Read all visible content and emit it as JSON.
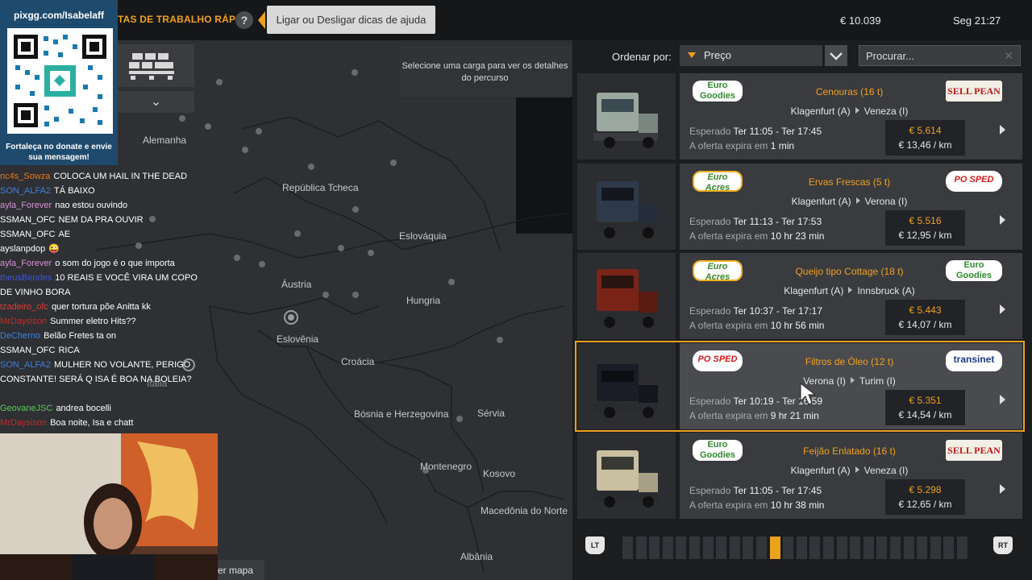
{
  "top_bar": {
    "quick_jobs_title": "TAS DE TRABALHO RÁPIDO",
    "help_icon_glyph": "?",
    "tip_toggle_label": "Ligar ou Desligar dicas de ajuda",
    "money": "€ 10.039",
    "clock": "Seg 21:27"
  },
  "map": {
    "route_hint": "Selecione uma carga para ver os detalhes do percurso",
    "view_map_label": "er mapa",
    "expand_glyph": "⌄",
    "countries": [
      {
        "name": "Alemanha"
      },
      {
        "name": "República Tcheca"
      },
      {
        "name": "Eslováquia"
      },
      {
        "name": "Áustria"
      },
      {
        "name": "Hungria"
      },
      {
        "name": "Eslovênia"
      },
      {
        "name": "Croácia"
      },
      {
        "name": "Bósnia e Herzegovina"
      },
      {
        "name": "Sérvia"
      },
      {
        "name": "Montenegro"
      },
      {
        "name": "Kosovo"
      },
      {
        "name": "Macedônia do Norte"
      },
      {
        "name": "Albânia"
      },
      {
        "name": "Itália"
      }
    ]
  },
  "stream_overlay": {
    "donate_title": "pixgg.com/Isabelaff",
    "donate_message": "Fortaleça no donate e envie sua mensagem!",
    "chat": [
      {
        "user": "nc4s_Sowza",
        "user_color": "#e07a1f",
        "message": "COLOCA UM HAIL IN THE DEAD"
      },
      {
        "user": "SON_ALFA2",
        "user_color": "#3d7fe0",
        "message": "TÁ BAIXO"
      },
      {
        "user": "ayla_Forever",
        "user_color": "#d68fd6",
        "message": "nao estou ouvindo"
      },
      {
        "user": "SSMAN_OFC",
        "user_color": "#ffffff",
        "message": "NEM DA PRA OUVIR"
      },
      {
        "user": "SSMAN_OFC",
        "user_color": "#ffffff",
        "message": "AE"
      },
      {
        "user": "ayslanpdop",
        "user_color": "#ffffff",
        "message": "😜"
      },
      {
        "user": "ayla_Forever",
        "user_color": "#d68fd6",
        "message": "o som do jogo é o que importa"
      },
      {
        "user": "theusBendes",
        "user_color": "#3a55d6",
        "message": "10 REAIS E VOCÊ VIRA UM COPO DE VINHO BORA"
      },
      {
        "user": "tzadeiro_ofc",
        "user_color": "#e03a3a",
        "message": "quer tortura põe Anitta kk"
      },
      {
        "user": "MrDaysison",
        "user_color": "#c02a2a",
        "message": "Summer eletro Hits??"
      },
      {
        "user": "DeCherno",
        "user_color": "#3d7fe0",
        "message": "Belão Fretes ta on"
      },
      {
        "user": "SSMAN_OFC",
        "user_color": "#ffffff",
        "message": "RICA"
      },
      {
        "user": "SON_ALFA2",
        "user_color": "#3d7fe0",
        "message": "MULHER NO VOLANTE, PERIGO CONSTANTE! SERÁ Q ISA É BOA NA BOLEIA?"
      },
      {
        "user": "GeovaneJSC",
        "user_color": "#58c858",
        "message": "andrea bocelli"
      },
      {
        "user": "MrDaysison",
        "user_color": "#c02a2a",
        "message": "Boa noite, Isa e chatt"
      }
    ]
  },
  "sort": {
    "label": "Ordenar por:",
    "selected": "Preço",
    "search_placeholder": "Procurar..."
  },
  "jobs": [
    {
      "cargo": "Cenouras (16 t)",
      "origin": "Klagenfurt (A)",
      "destination": "Veneza (I)",
      "eta_label": "Esperado",
      "eta": "Ter 11:05 - Ter 17:45",
      "expiry_label": "A oferta expira em",
      "expiry": "1 min",
      "price": "€ 5.614",
      "per_km": "€ 13,46 / km",
      "source_company": "Euro Goodies",
      "target_company": "SELL PEAN",
      "truck_color": "#9aa8a0",
      "selected": false
    },
    {
      "cargo": "Ervas Frescas (5 t)",
      "origin": "Klagenfurt (A)",
      "destination": "Verona (I)",
      "eta_label": "Esperado",
      "eta": "Ter 11:13 - Ter 17:53",
      "expiry_label": "A oferta expira em",
      "expiry": "10 hr 23 min",
      "price": "€ 5.516",
      "per_km": "€ 12,95 / km",
      "source_company": "Euro Acres",
      "target_company": "PO SPED",
      "truck_color": "#2e3a4a",
      "selected": false
    },
    {
      "cargo": "Queijo tipo Cottage (18 t)",
      "origin": "Klagenfurt (A)",
      "destination": "Innsbruck (A)",
      "eta_label": "Esperado",
      "eta": "Ter 10:37 - Ter 17:17",
      "expiry_label": "A oferta expira em",
      "expiry": "10 hr 56 min",
      "price": "€ 5.443",
      "per_km": "€ 14,07 / km",
      "source_company": "Euro Acres",
      "target_company": "Euro Goodies",
      "truck_color": "#7a2418",
      "selected": false
    },
    {
      "cargo": "Filtros de Óleo (12 t)",
      "origin": "Verona (I)",
      "destination": "Turim (I)",
      "eta_label": "Esperado",
      "eta": "Ter 10:19 - Ter 16:59",
      "expiry_label": "A oferta expira em",
      "expiry": "9 hr 21 min",
      "price": "€ 5.351",
      "per_km": "€ 14,54 / km",
      "source_company": "PO SPED",
      "target_company": "transinet",
      "truck_color": "#1a1d26",
      "selected": true
    },
    {
      "cargo": "Feijão Enlatado (16 t)",
      "origin": "Klagenfurt (A)",
      "destination": "Veneza (I)",
      "eta_label": "Esperado",
      "eta": "Ter 11:05 - Ter 17:45",
      "expiry_label": "A oferta expira em",
      "expiry": "10 hr 38 min",
      "price": "€ 5.298",
      "per_km": "€ 12,65 / km",
      "source_company": "Euro Goodies",
      "target_company": "SELL PEAN",
      "truck_color": "#c8c0a0",
      "selected": false
    }
  ],
  "pager": {
    "left_button": "LT",
    "right_button": "RT",
    "total_pages": 26,
    "current_page": 12
  }
}
